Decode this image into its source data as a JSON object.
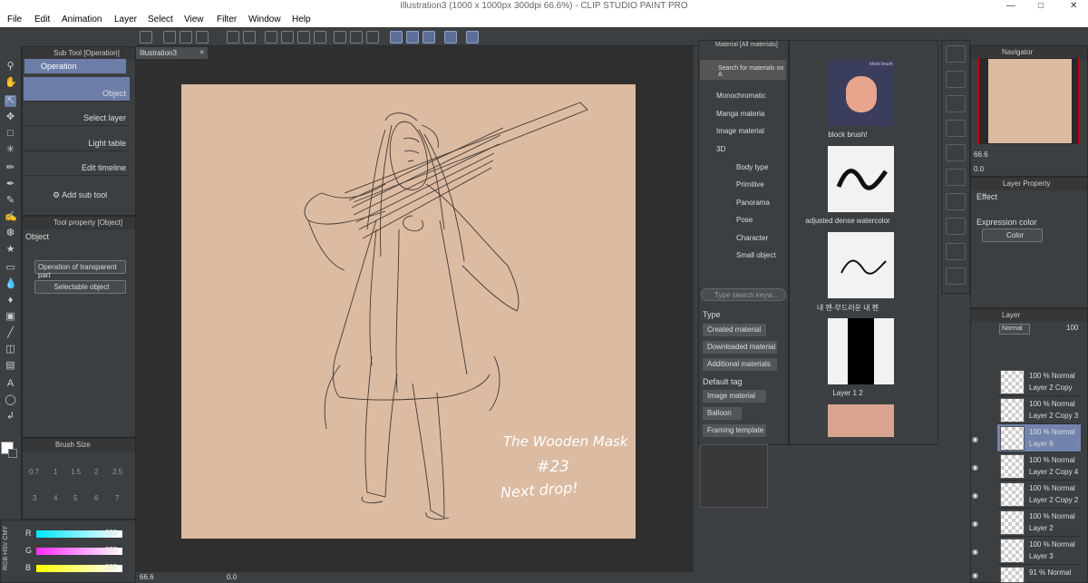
{
  "title": "Illustration3 (1000 x 1000px 300dpi 66.6%)  - CLIP STUDIO PAINT PRO",
  "menu": [
    "File",
    "Edit",
    "Animation",
    "Layer",
    "Select",
    "View",
    "Filter",
    "Window",
    "Help"
  ],
  "canvas_tab": "Illustration3",
  "subtool_panel": {
    "title": "Sub Tool [Operation]",
    "group": "Operation",
    "items": [
      "Object",
      "Select layer",
      "Light table",
      "Edit timeline"
    ],
    "add": "Add sub tool"
  },
  "tool_property": {
    "title": "Tool property [Object]",
    "section": "Object",
    "dropdown1": "Operation of transparent part",
    "dropdown2": "Selectable object"
  },
  "brush_size": {
    "title": "Brush Size",
    "row1": [
      "0.7",
      "1",
      "1.5",
      "2",
      "2.5"
    ],
    "row2": [
      "3",
      "4",
      "5",
      "6",
      "7"
    ]
  },
  "color_sliders": [
    {
      "label": "R",
      "value": "255",
      "color": "#00e5ff"
    },
    {
      "label": "G",
      "value": "255",
      "color": "#ff2bff"
    },
    {
      "label": "B",
      "value": "255",
      "color": "#ffff00"
    }
  ],
  "color_mode_tabs": [
    "RGB",
    "HSV",
    "CMY"
  ],
  "status": {
    "zoom": "66.6",
    "angle": "0.0"
  },
  "artwork_text": [
    "The Wooden Mask",
    "#23",
    "Next drop!"
  ],
  "material": {
    "title": "Material [All materials]",
    "search_online": "Search for materials on A",
    "tree": [
      "Monochromatic",
      "Manga materia",
      "Image material",
      "3D",
      "Body type",
      "Primitive",
      "Panorama",
      "Pose",
      "Character",
      "Small object"
    ],
    "search_placeholder": "Type search keyw...",
    "type_label": "Type",
    "type_buttons": [
      "Created material",
      "Downloaded material",
      "Additional materials"
    ],
    "default_tag_label": "Default tag",
    "tag_buttons": [
      "Image material",
      "Balloon",
      "Framing template"
    ],
    "thumbs": [
      "block brush!",
      "adjusted dense watercolor",
      "내 펜-부드러운 내 펜",
      "Layer 1 2"
    ],
    "thumb_header": "block brush"
  },
  "navigator": {
    "title": "Navigator",
    "zoom": "66.6",
    "angle": "0.0"
  },
  "layer_property": {
    "title": "Layer Property",
    "effect": "Effect",
    "expression": "Expression color",
    "color": "Color"
  },
  "layer_panel": {
    "title": "Layer",
    "blend": "Normal",
    "opacity": "100",
    "layers": [
      {
        "opacity": "100 % Normal",
        "name": "Layer 2 Copy"
      },
      {
        "opacity": "100 % Normal",
        "name": "Layer 2 Copy 3"
      },
      {
        "opacity": "100 % Normal",
        "name": "Layer 6"
      },
      {
        "opacity": "100 % Normal",
        "name": "Layer 2 Copy 4"
      },
      {
        "opacity": "100 % Normal",
        "name": "Layer 2 Copy 2"
      },
      {
        "opacity": "100 % Normal",
        "name": "Layer 2"
      },
      {
        "opacity": "100 % Normal",
        "name": "Layer 3"
      },
      {
        "opacity": "91 % Normal",
        "name": ""
      }
    ]
  }
}
